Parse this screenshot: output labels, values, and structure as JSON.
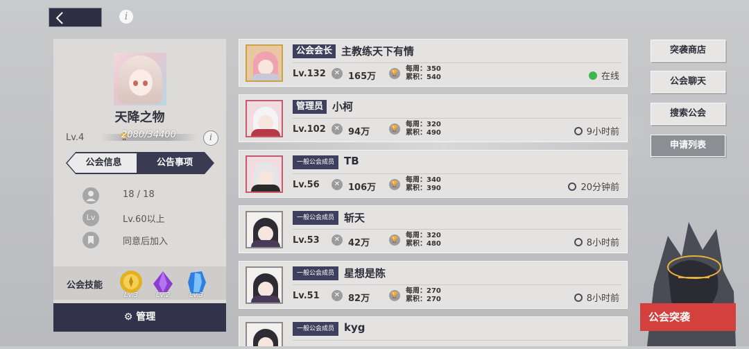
{
  "top": {
    "back_icon": "chevron-left-icon",
    "info_icon": "info-icon",
    "info_glyph": "i"
  },
  "guild": {
    "name": "天降之物",
    "level": "Lv.4",
    "exp": "2080/34400",
    "tabs": [
      {
        "label": "公会信息",
        "active": true
      },
      {
        "label": "公告事项",
        "active": false
      }
    ],
    "members_count": "18 / 18",
    "level_requirement": "Lv.60以上",
    "join_mode": "同意后加入",
    "lv_badge": "Lv",
    "skills_label": "公会技能",
    "skills": [
      {
        "name": "gold-coin-icon",
        "level": "Lv.3"
      },
      {
        "name": "purple-crystal-icon",
        "level": "Lv.2"
      },
      {
        "name": "blue-crystal-icon",
        "level": "Lv.3"
      }
    ],
    "manage_label": "管理"
  },
  "members": [
    {
      "role": "公会会长",
      "name": "主教练天下有情",
      "level": "Lv.132",
      "power": "165万",
      "weekly": "每周：350",
      "total": "累积：540",
      "status": "在线",
      "online": true
    },
    {
      "role": "管理员",
      "name": "小柯",
      "level": "Lv.102",
      "power": "94万",
      "weekly": "每周：320",
      "total": "累积：490",
      "status": "9小时前",
      "online": false
    },
    {
      "role": "一般公会成员",
      "name": "TB",
      "level": "Lv.56",
      "power": "106万",
      "weekly": "每周：340",
      "total": "累积：390",
      "status": "20分钟前",
      "online": false
    },
    {
      "role": "一般公会成员",
      "name": "斩天",
      "level": "Lv.53",
      "power": "42万",
      "weekly": "每周：320",
      "total": "累积：480",
      "status": "8小时前",
      "online": false
    },
    {
      "role": "一般公会成员",
      "name": "星想是陈",
      "level": "Lv.51",
      "power": "82万",
      "weekly": "每周：270",
      "total": "累积：270",
      "status": "8小时前",
      "online": false
    },
    {
      "role": "一般公会成员",
      "name": "kyg",
      "level": "",
      "power": "",
      "weekly": "",
      "total": "",
      "status": "",
      "online": false
    }
  ],
  "right_menu": {
    "raid_shop": "突袭商店",
    "guild_chat": "公会聊天",
    "search_guild": "搜索公会",
    "apply_list": "申请列表",
    "guild_raid": "公会突袭"
  },
  "colors": {
    "dark": "#32334a",
    "online": "#3cb94a",
    "raid": "#d3403d"
  }
}
